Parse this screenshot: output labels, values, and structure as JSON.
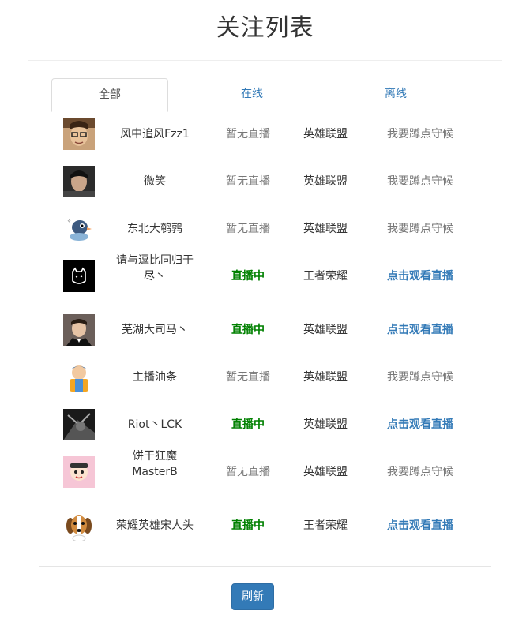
{
  "page": {
    "title": "关注列表"
  },
  "tabs": [
    {
      "label": "全部",
      "active": true
    },
    {
      "label": "在线",
      "active": false
    },
    {
      "label": "离线",
      "active": false
    }
  ],
  "streamers": [
    {
      "name": "风中追风Fzz1",
      "status": "暂无直播",
      "game": "英雄联盟",
      "action": "我要蹲点守候",
      "online": false,
      "avatar": "avatar-glasses-man"
    },
    {
      "name": "微笑",
      "status": "暂无直播",
      "game": "英雄联盟",
      "action": "我要蹲点守候",
      "online": false,
      "avatar": "avatar-dark-man"
    },
    {
      "name": "东北大鹌鹑",
      "status": "暂无直播",
      "game": "英雄联盟",
      "action": "我要蹲点守候",
      "online": false,
      "avatar": "avatar-cartoon-bird"
    },
    {
      "name": "请与逗比同归于尽丶",
      "status": "直播中",
      "game": "王者荣耀",
      "action": "点击观看直播",
      "online": true,
      "avatar": "avatar-black-cat-logo"
    },
    {
      "name": "芜湖大司马丶",
      "status": "直播中",
      "game": "英雄联盟",
      "action": "点击观看直播",
      "online": true,
      "avatar": "avatar-suit-man"
    },
    {
      "name": "主播油条",
      "status": "暂无直播",
      "game": "英雄联盟",
      "action": "我要蹲点守候",
      "online": false,
      "avatar": "avatar-cartoon-boy"
    },
    {
      "name": "Riot丶LCK",
      "status": "直播中",
      "game": "英雄联盟",
      "action": "点击观看直播",
      "online": true,
      "avatar": "avatar-dark-abstract"
    },
    {
      "name": "饼干狂魔MasterB",
      "status": "暂无直播",
      "game": "英雄联盟",
      "action": "我要蹲点守候",
      "online": false,
      "avatar": "avatar-pink-cartoon"
    },
    {
      "name": "荣耀英雄宋人头",
      "status": "直播中",
      "game": "王者荣耀",
      "action": "点击观看直播",
      "online": true,
      "avatar": "avatar-beagle-dog"
    }
  ],
  "footer": {
    "refresh_label": "刷新"
  },
  "colors": {
    "online": "#008000",
    "link": "#337ab7",
    "muted": "#777777",
    "button": "#337ab7"
  }
}
